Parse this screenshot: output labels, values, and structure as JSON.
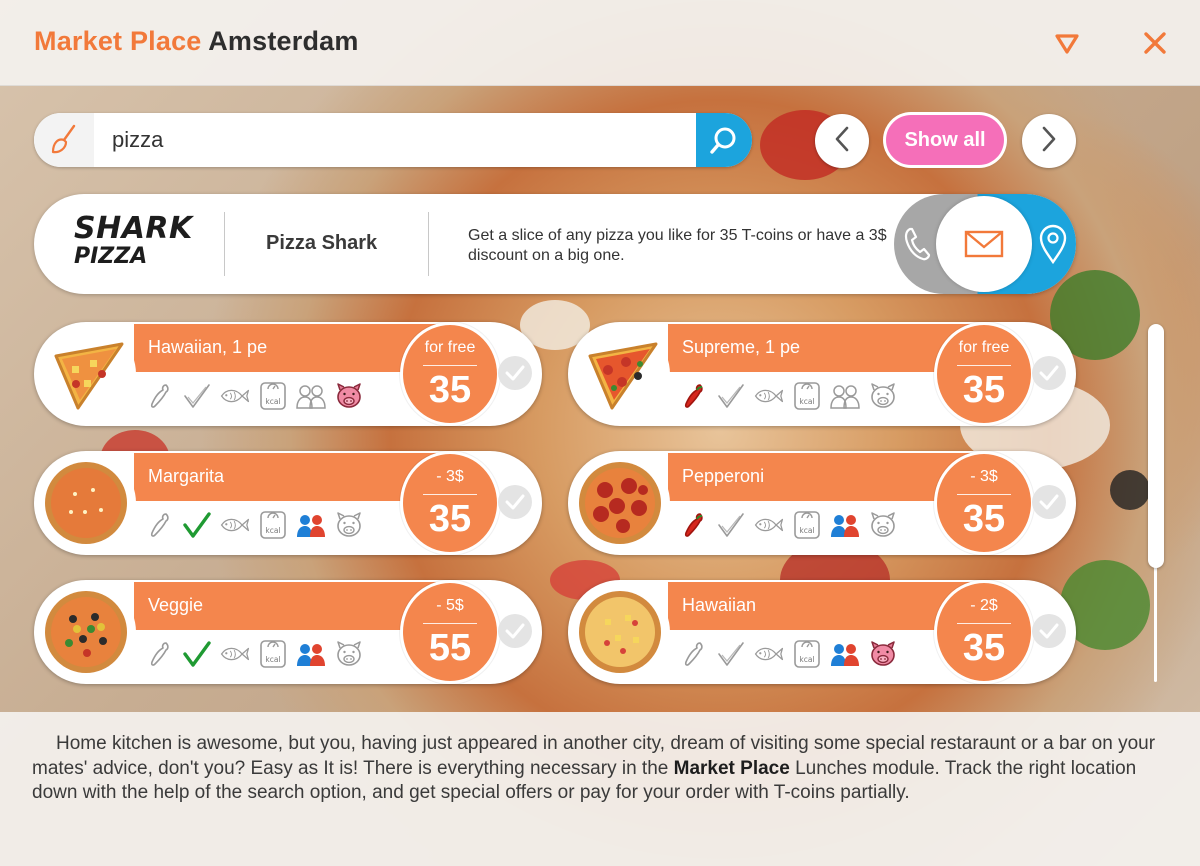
{
  "header": {
    "title_part1": "Market Place",
    "title_part2": "Amsterdam"
  },
  "search": {
    "value": "pizza",
    "placeholder": ""
  },
  "nav": {
    "show_all_label": "Show all"
  },
  "restaurant": {
    "logo_line1": "SHARK",
    "logo_line2": "PIZZA",
    "name": "Pizza Shark",
    "description": "Get a slice of any pizza you like for 35 T-coins or have a 3$ discount on a big one."
  },
  "items": [
    {
      "name": "Hawaiian, 1 pe",
      "price_label": "for free",
      "price": "35",
      "image": "pizza-slice-hawaiian-icon",
      "icons": {
        "spicy": false,
        "vegan": false,
        "fish": false,
        "kcal": false,
        "kids": false,
        "pork": true
      }
    },
    {
      "name": "Supreme, 1 pe",
      "price_label": "for free",
      "price": "35",
      "image": "pizza-slice-supreme-icon",
      "icons": {
        "spicy": true,
        "vegan": false,
        "fish": false,
        "kcal": false,
        "kids": false,
        "pork": false
      }
    },
    {
      "name": "Margarita",
      "price_label": "- 3$",
      "price": "35",
      "image": "pizza-margarita-icon",
      "icons": {
        "spicy": false,
        "vegan": true,
        "fish": false,
        "kcal": false,
        "kids": true,
        "pork": false
      }
    },
    {
      "name": "Pepperoni",
      "price_label": "- 3$",
      "price": "35",
      "image": "pizza-pepperoni-icon",
      "icons": {
        "spicy": true,
        "vegan": false,
        "fish": false,
        "kcal": false,
        "kids": true,
        "pork": false
      }
    },
    {
      "name": "Veggie",
      "price_label": "- 5$",
      "price": "55",
      "image": "pizza-veggie-icon",
      "icons": {
        "spicy": false,
        "vegan": true,
        "fish": false,
        "kcal": false,
        "kids": true,
        "pork": false
      }
    },
    {
      "name": "Hawaiian",
      "price_label": "- 2$",
      "price": "35",
      "image": "pizza-hawaiian-icon",
      "icons": {
        "spicy": false,
        "vegan": false,
        "fish": false,
        "kcal": false,
        "kids": true,
        "pork": true
      }
    }
  ],
  "footer": {
    "text_before": "Home kitchen is awesome, but you, having just appeared in another city, dream of visiting some special restaraunt or a bar on your mates' advice, don't you? Easy as It is! There is everything necessary in the ",
    "bold": "Market Place",
    "text_after": " Lunches module. Track the right location down with the help of the search option, and get special offers or pay for your order with T-coins partially."
  },
  "colors": {
    "accent": "#f4864d",
    "title_orange": "#f2793a",
    "blue": "#1ca4dd",
    "pink": "#f56fb9",
    "grey": "#a7a7a7"
  },
  "icons": {
    "header": [
      "dropdown-triangle-icon",
      "close-icon"
    ],
    "search": [
      "broom-icon",
      "search-icon"
    ],
    "nav": [
      "chevron-left-icon",
      "chevron-right-icon"
    ],
    "contact": [
      "phone-icon",
      "mail-icon",
      "location-pin-icon"
    ],
    "item_attributes": [
      "chili-icon",
      "vegan-check-icon",
      "fish-icon",
      "kcal-scale-icon",
      "kids-icon",
      "pig-icon"
    ]
  },
  "kcal_label": "kcal"
}
